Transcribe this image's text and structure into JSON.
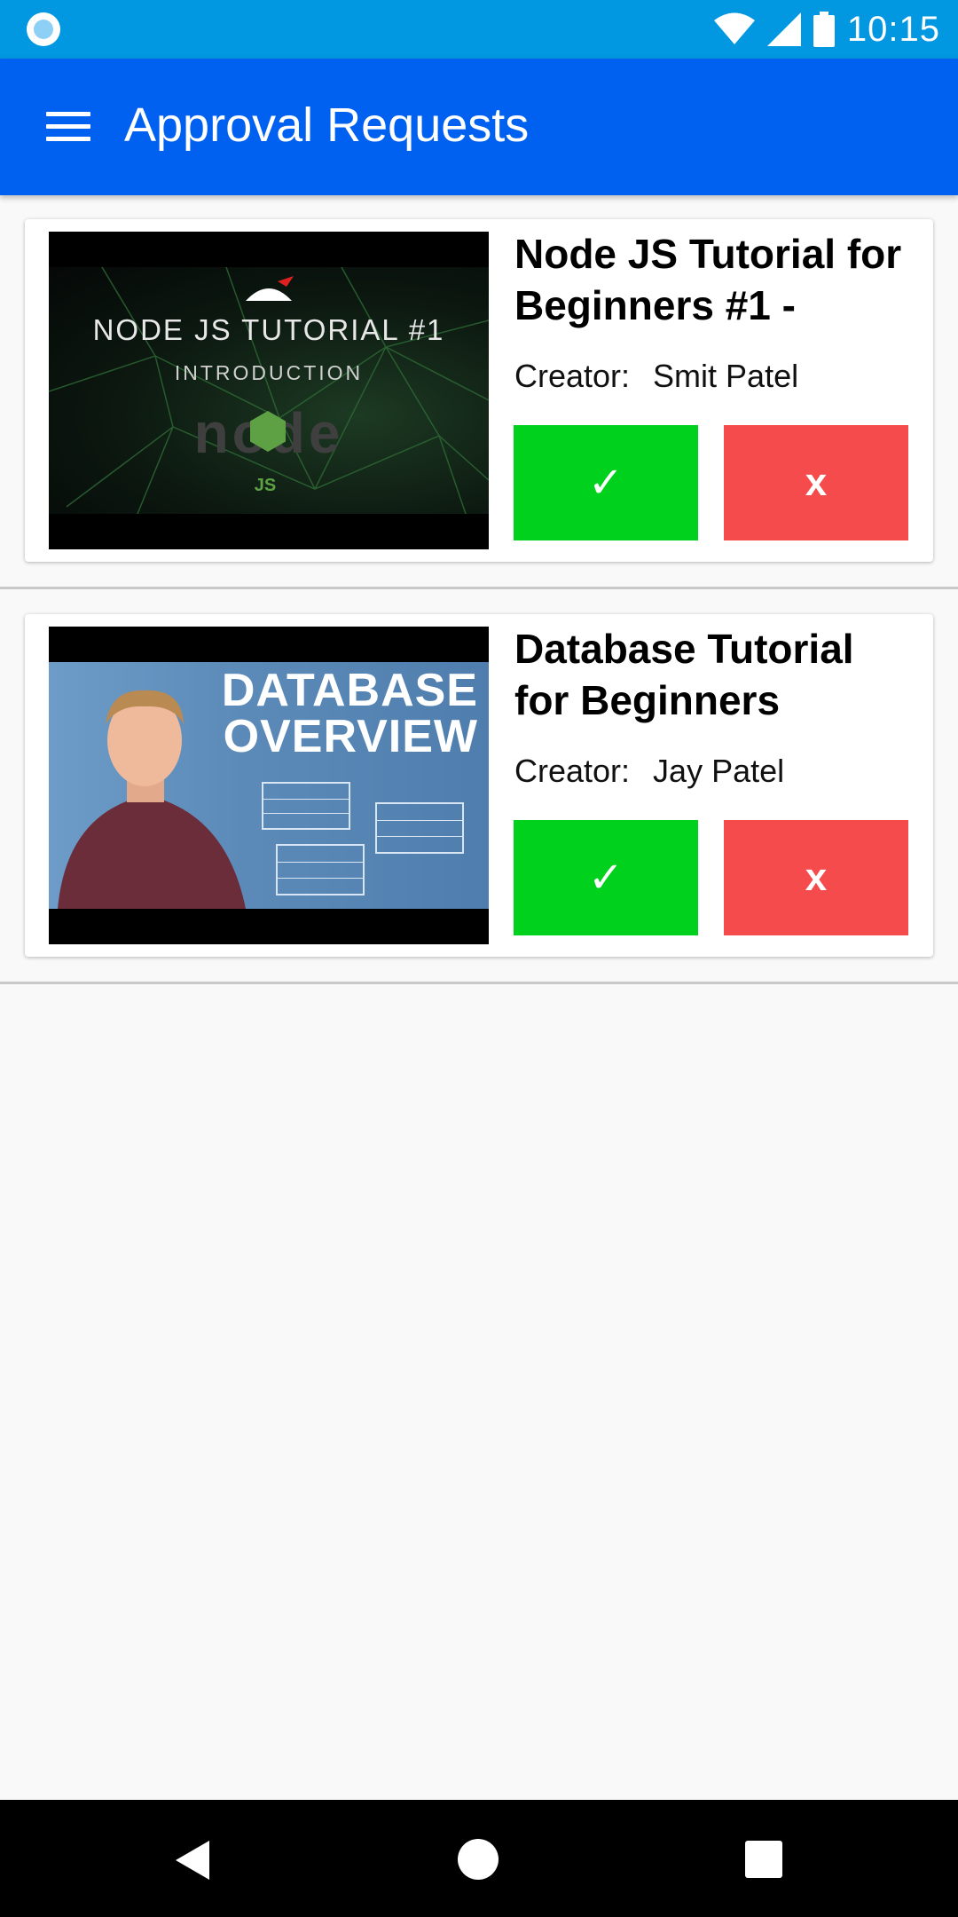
{
  "status_bar": {
    "time": "10:15"
  },
  "app_bar": {
    "title": "Approval Requests"
  },
  "requests": [
    {
      "title": "Node JS Tutorial for Beginners #1 -",
      "creator_label": "Creator:",
      "creator_name": "Smit Patel",
      "thumbnail": {
        "line1": "NODE JS TUTORIAL  #1",
        "line2": "INTRODUCTION",
        "logo": "node",
        "logo_sub": "JS"
      },
      "approve_label": "✓",
      "reject_label": "x"
    },
    {
      "title": "Database Tutorial for Beginners",
      "creator_label": "Creator:",
      "creator_name": "Jay Patel",
      "thumbnail": {
        "line1": "DATABASE",
        "line2": "OVERVIEW"
      },
      "approve_label": "✓",
      "reject_label": "x"
    }
  ],
  "colors": {
    "status_bar": "#0197e1",
    "app_bar": "#0060f0",
    "approve": "#00d11c",
    "reject": "#f64b4c",
    "background": "#f9f9f9"
  },
  "icons": {
    "status": [
      "notification-dot-icon",
      "wifi-icon",
      "cell-signal-icon",
      "battery-icon"
    ],
    "app_bar": "menu-icon",
    "nav": [
      "back-icon",
      "home-icon",
      "recents-icon"
    ]
  }
}
